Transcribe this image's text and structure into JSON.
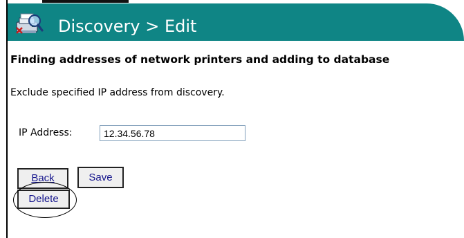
{
  "header": {
    "title": "Discovery > Edit",
    "icon": "network-printer-discovery-icon"
  },
  "subtitle": "Finding addresses of network printers and adding to database",
  "description": "Exclude specified IP address from discovery.",
  "form": {
    "ip_label": "IP Address:",
    "ip_value": "12.34.56.78"
  },
  "buttons": {
    "back_label": "Back",
    "save_label": "Save",
    "delete_label": "Delete"
  },
  "colors": {
    "header_bg": "#0f8585",
    "header_text": "#ffffff",
    "button_text": "#14148c"
  }
}
